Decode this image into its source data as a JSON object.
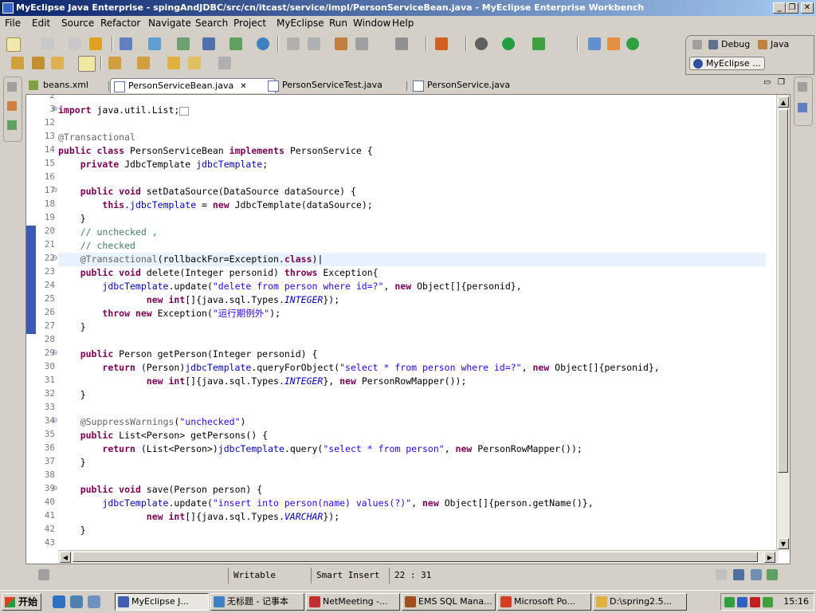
{
  "window": {
    "title": "MyEclipse Java Enterprise - spingAndJDBC/src/cn/itcast/service/impl/PersonServiceBean.java - MyEclipse Enterprise Workbench",
    "min": "_",
    "max": "❐",
    "close": "✕"
  },
  "menu": [
    "File",
    "Edit",
    "Source",
    "Refactor",
    "Navigate",
    "Search",
    "Project",
    "MyEclipse",
    "Run",
    "Window",
    "Help"
  ],
  "perspectives": {
    "debug": "Debug",
    "java": "Java",
    "myeclipse": "MyEclipse ..."
  },
  "tabs": [
    {
      "label": "beans.xml",
      "active": false
    },
    {
      "label": "PersonServiceBean.java",
      "active": true
    },
    {
      "label": "PersonServiceTest.java",
      "active": false
    },
    {
      "label": "PersonService.java",
      "active": false
    }
  ],
  "tab_close": "✕",
  "editor": {
    "lines": [
      {
        "n": "2",
        "html": ""
      },
      {
        "n": "3",
        "html": "<span class=\"kw\">import</span> java.util.List;<span style=\"border:1px solid #999;font-size:8px\">&nbsp;&nbsp;</span>"
      },
      {
        "n": "12",
        "html": ""
      },
      {
        "n": "13",
        "html": "<span class=\"an\">@Transactional</span>"
      },
      {
        "n": "14",
        "html": "<span class=\"kw\">public class</span> PersonServiceBean <span class=\"kw\">implements</span> PersonService {"
      },
      {
        "n": "15",
        "html": "    <span class=\"kw\">private</span> JdbcTemplate <span class=\"fd\">jdbcTemplate</span>;"
      },
      {
        "n": "16",
        "html": ""
      },
      {
        "n": "17",
        "html": "    <span class=\"kw\">public void</span> setDataSource(DataSource dataSource) {"
      },
      {
        "n": "18",
        "html": "        <span class=\"kw\">this</span>.<span class=\"fd\">jdbcTemplate</span> = <span class=\"kw\">new</span> JdbcTemplate(dataSource);"
      },
      {
        "n": "19",
        "html": "    }"
      },
      {
        "n": "20",
        "html": "    <span class=\"cm\">// unchecked ,</span>"
      },
      {
        "n": "21",
        "html": "    <span class=\"cm\">// checked</span>"
      },
      {
        "n": "22",
        "html": "    <span class=\"an\">@Transactional</span>(rollbackFor=Exception.<span class=\"kw\">class</span>)|"
      },
      {
        "n": "23",
        "html": "    <span class=\"kw\">public void</span> delete(Integer personid) <span class=\"kw\">throws</span> Exception{"
      },
      {
        "n": "24",
        "html": "        <span class=\"fd\">jdbcTemplate</span>.update(<span class=\"st\">\"delete from person where id=?\"</span>, <span class=\"kw\">new</span> Object[]{personid},"
      },
      {
        "n": "25",
        "html": "                <span class=\"kw\">new int</span>[]{java.sql.Types.<span class=\"it\">INTEGER</span>});"
      },
      {
        "n": "26",
        "html": "        <span class=\"kw\">throw new</span> Exception(<span class=\"st\">\"运行期例外\"</span>);"
      },
      {
        "n": "27",
        "html": "    }"
      },
      {
        "n": "28",
        "html": ""
      },
      {
        "n": "29",
        "html": "    <span class=\"kw\">public</span> Person getPerson(Integer personid) {"
      },
      {
        "n": "30",
        "html": "        <span class=\"kw\">return</span> (Person)<span class=\"fd\">jdbcTemplate</span>.queryForObject(<span class=\"st\">\"select * from person where id=?\"</span>, <span class=\"kw\">new</span> Object[]{personid},"
      },
      {
        "n": "31",
        "html": "                <span class=\"kw\">new int</span>[]{java.sql.Types.<span class=\"it\">INTEGER</span>}, <span class=\"kw\">new</span> PersonRowMapper());"
      },
      {
        "n": "32",
        "html": "    }"
      },
      {
        "n": "33",
        "html": ""
      },
      {
        "n": "34",
        "html": "    <span class=\"an\">@SuppressWarnings</span>(<span class=\"st\">\"unchecked\"</span>)"
      },
      {
        "n": "35",
        "html": "    <span class=\"kw\">public</span> List&lt;Person&gt; getPersons() {"
      },
      {
        "n": "36",
        "html": "        <span class=\"kw\">return</span> (List&lt;Person&gt;)<span class=\"fd\">jdbcTemplate</span>.query(<span class=\"st\">\"select * from person\"</span>, <span class=\"kw\">new</span> PersonRowMapper());"
      },
      {
        "n": "37",
        "html": "    }"
      },
      {
        "n": "38",
        "html": ""
      },
      {
        "n": "39",
        "html": "    <span class=\"kw\">public void</span> save(Person person) {"
      },
      {
        "n": "40",
        "html": "        <span class=\"fd\">jdbcTemplate</span>.update(<span class=\"st\">\"insert into person(name) values(?)\"</span>, <span class=\"kw\">new</span> Object[]{person.getName()},"
      },
      {
        "n": "41",
        "html": "                <span class=\"kw\">new int</span>[]{java.sql.Types.<span class=\"it\">VARCHAR</span>});"
      },
      {
        "n": "42",
        "html": "    }"
      },
      {
        "n": "43",
        "html": ""
      }
    ],
    "current_line": "22",
    "folds": {
      "3": "+",
      "17": "−",
      "22": "−",
      "29": "−",
      "34": "−",
      "39": "−"
    }
  },
  "status": {
    "writable": "Writable",
    "insert_mode": "Smart Insert",
    "position": "22 : 31"
  },
  "taskbar": {
    "start": "开始",
    "tasks": [
      {
        "label": "MyEclipse J...",
        "active": true,
        "color": "#4060b0"
      },
      {
        "label": "无标题 - 记事本",
        "active": false,
        "color": "#4080c0"
      },
      {
        "label": "NetMeeting -...",
        "active": false,
        "color": "#c03030"
      },
      {
        "label": "EMS SQL Mana...",
        "active": false,
        "color": "#a05020"
      },
      {
        "label": "Microsoft Po...",
        "active": false,
        "color": "#d04020"
      },
      {
        "label": "D:\\spring2.5...",
        "active": false,
        "color": "#e0b040"
      }
    ],
    "clock": "15:16"
  }
}
